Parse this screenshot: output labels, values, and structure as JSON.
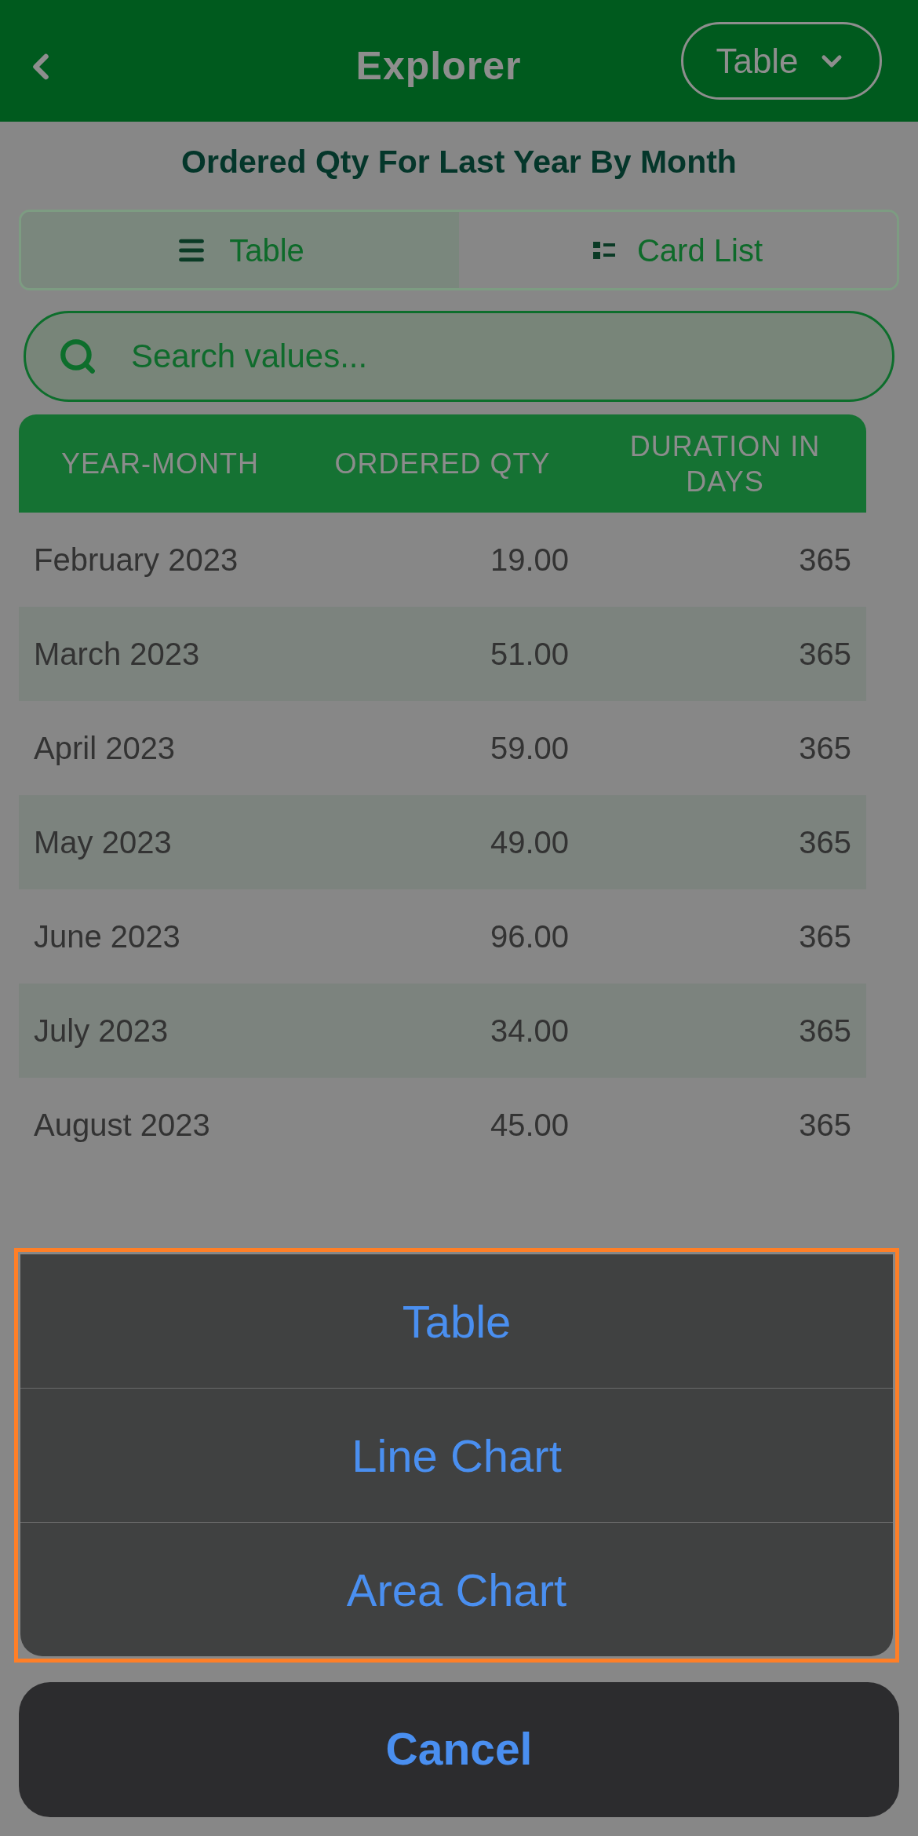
{
  "header": {
    "title": "Explorer",
    "view_dropdown": {
      "label": "Table"
    }
  },
  "subtitle": "Ordered Qty For Last Year By Month",
  "view_tabs": [
    {
      "label": "Table",
      "kind": "table",
      "selected": true
    },
    {
      "label": "Card List",
      "kind": "cards",
      "selected": false
    }
  ],
  "search": {
    "placeholder": "Search values..."
  },
  "table": {
    "columns": [
      "YEAR-MONTH",
      "ORDERED QTY",
      "DURATION IN DAYS"
    ],
    "rows": [
      [
        "February 2023",
        "19.00",
        "365"
      ],
      [
        "March 2023",
        "51.00",
        "365"
      ],
      [
        "April 2023",
        "59.00",
        "365"
      ],
      [
        "May 2023",
        "49.00",
        "365"
      ],
      [
        "June 2023",
        "96.00",
        "365"
      ],
      [
        "July 2023",
        "34.00",
        "365"
      ],
      [
        "August 2023",
        "45.00",
        "365"
      ]
    ]
  },
  "action_sheet": {
    "highlighted": true,
    "options": [
      "Table",
      "Line Chart",
      "Area Chart"
    ],
    "cancel": "Cancel"
  }
}
